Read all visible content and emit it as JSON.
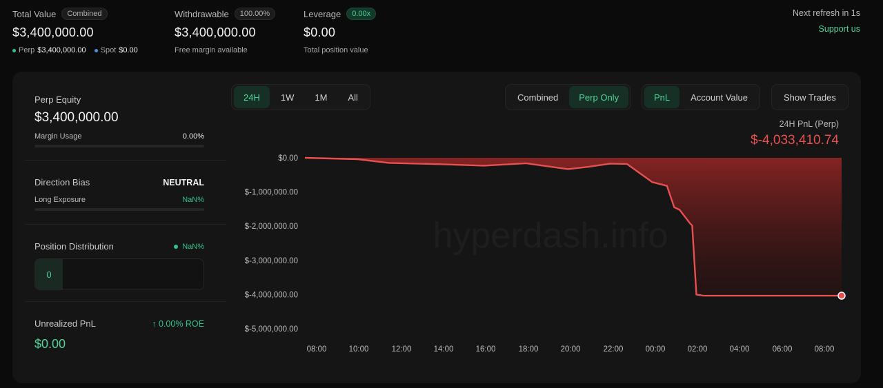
{
  "summary": {
    "total_value": {
      "label": "Total Value",
      "badge": "Combined",
      "value": "$3,400,000.00",
      "perp_label": "Perp",
      "perp_value": "$3,400,000.00",
      "spot_label": "Spot",
      "spot_value": "$0.00"
    },
    "withdrawable": {
      "label": "Withdrawable",
      "badge": "100.00%",
      "value": "$3,400,000.00",
      "sub": "Free margin available"
    },
    "leverage": {
      "label": "Leverage",
      "badge": "0.00x",
      "value": "$0.00",
      "sub": "Total position value"
    },
    "refresh": "Next refresh in 1s",
    "support": "Support us"
  },
  "left_panel": {
    "perp_equity": {
      "title": "Perp Equity",
      "value": "$3,400,000.00",
      "margin_label": "Margin Usage",
      "margin_value": "0.00%",
      "margin_fraction": 0
    },
    "direction": {
      "title": "Direction Bias",
      "value": "NEUTRAL",
      "exposure_label": "Long Exposure",
      "exposure_value": "NaN%"
    },
    "distribution": {
      "title": "Position Distribution",
      "value": "NaN%",
      "count": "0"
    },
    "unrealized": {
      "title": "Unrealized PnL",
      "roe": "↑ 0.00% ROE",
      "value": "$0.00"
    }
  },
  "controls": {
    "ranges": [
      "24H",
      "1W",
      "1M",
      "All"
    ],
    "active_range": "24H",
    "scope": [
      "Combined",
      "Perp Only"
    ],
    "active_scope": "Perp Only",
    "metric": [
      "PnL",
      "Account Value"
    ],
    "active_metric": "PnL",
    "show_trades": "Show Trades"
  },
  "chart_header": {
    "label": "24H PnL (Perp)",
    "value": "$-4,033,410.74"
  },
  "watermark": "hyperdash.info",
  "colors": {
    "accent": "#4fd39a",
    "loss": "#e85050"
  },
  "chart_data": {
    "type": "area",
    "x_ticks": [
      "08:00",
      "10:00",
      "12:00",
      "14:00",
      "16:00",
      "18:00",
      "20:00",
      "22:00",
      "00:00",
      "02:00",
      "04:00",
      "06:00",
      "08:00"
    ],
    "y_ticks": [
      "$0.00",
      "$-1,000,000.00",
      "$-2,000,000.00",
      "$-3,000,000.00",
      "$-4,000,000.00",
      "$-5,000,000.00"
    ],
    "ylim": [
      -5000000,
      0
    ],
    "x_hours": [
      0,
      2.5,
      4,
      6,
      8.5,
      10.5,
      12.5,
      13.5,
      14.5,
      15.3,
      16.5,
      17.2,
      17.55,
      17.8,
      18.3,
      18.4,
      18.6,
      18.9,
      19.1,
      19.15,
      25.5
    ],
    "values": [
      0,
      -40000,
      -150000,
      -180000,
      -230000,
      -160000,
      -330000,
      -260000,
      -170000,
      -180000,
      -710000,
      -820000,
      -1450000,
      -1520000,
      -1920000,
      -1980000,
      -4000000,
      -4030000,
      -4033410,
      -4033410,
      -4033410
    ],
    "x_range_hours": [
      0,
      25.5
    ],
    "grid": false,
    "last_point_marker": true
  }
}
